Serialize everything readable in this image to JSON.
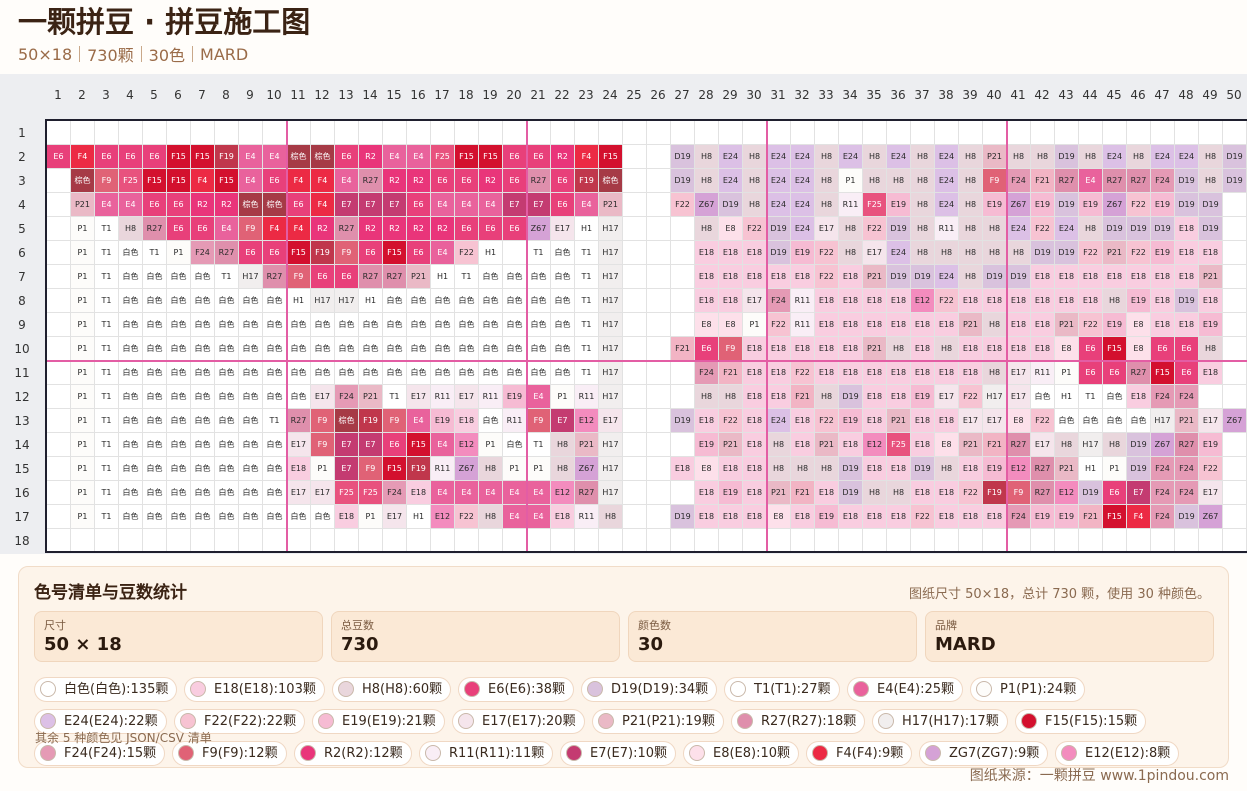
{
  "header": {
    "title": "一颗拼豆 · 拼豆施工图",
    "size": "50×18",
    "beads": "730颗",
    "colors": "30色",
    "brand": "MARD"
  },
  "grid": {
    "cols": 50,
    "rows": 18,
    "major_every": 10,
    "rows_data": [
      [],
      [
        "E6",
        "F4",
        "E6",
        "E6",
        "E6",
        "F15",
        "F15",
        "F19",
        "E4",
        "E4",
        "棕色",
        "棕色",
        "E6",
        "R2",
        "E4",
        "E4",
        "F25",
        "F15",
        "F15",
        "E6",
        "E6",
        "R2",
        "F4",
        "F15",
        "",
        "",
        "D19",
        "H8",
        "E24",
        "H8",
        "E24",
        "E24",
        "H8",
        "E24",
        "H8",
        "E24",
        "H8",
        "E24",
        "H8",
        "P21",
        "H8",
        "H8",
        "D19",
        "H8",
        "E24",
        "H8",
        "E24",
        "E24",
        "H8",
        "D19"
      ],
      [
        "",
        "棕色",
        "F9",
        "F25",
        "F15",
        "F15",
        "F4",
        "F15",
        "E4",
        "E6",
        "F4",
        "F4",
        "E4",
        "R27",
        "R2",
        "R2",
        "E6",
        "E6",
        "R2",
        "E6",
        "R27",
        "E6",
        "F19",
        "棕色",
        "",
        "",
        "D19",
        "H8",
        "E24",
        "H8",
        "E24",
        "E24",
        "H8",
        "P1",
        "H8",
        "H8",
        "H8",
        "E24",
        "H8",
        "F9",
        "F24",
        "F21",
        "R27",
        "E4",
        "R27",
        "R27",
        "F24",
        "D19",
        "H8",
        "D19"
      ],
      [
        "",
        "P21",
        "E4",
        "E4",
        "E6",
        "E6",
        "R2",
        "R2",
        "棕色",
        "棕色",
        "E6",
        "F4",
        "E7",
        "E7",
        "E7",
        "E6",
        "E4",
        "E4",
        "E4",
        "E7",
        "E7",
        "E6",
        "E4",
        "P21",
        "",
        "",
        "F22",
        "Z67",
        "D19",
        "H8",
        "E24",
        "E24",
        "H8",
        "R11",
        "F25",
        "E19",
        "H8",
        "E24",
        "H8",
        "E19",
        "Z67",
        "E19",
        "D19",
        "E19",
        "Z67",
        "F22",
        "E19",
        "D19",
        "D19",
        ""
      ],
      [
        "",
        "P1",
        "T1",
        "H8",
        "R27",
        "E6",
        "E6",
        "E4",
        "F9",
        "F4",
        "F4",
        "R2",
        "R27",
        "R2",
        "R2",
        "R2",
        "R2",
        "E6",
        "E6",
        "E6",
        "Z67",
        "E17",
        "H1",
        "H17",
        "",
        "",
        "",
        "H8",
        "E8",
        "F22",
        "D19",
        "E24",
        "E17",
        "H8",
        "F22",
        "D19",
        "H8",
        "R11",
        "H8",
        "H8",
        "E24",
        "F22",
        "E24",
        "H8",
        "D19",
        "D19",
        "D19",
        "E18",
        "D19",
        ""
      ],
      [
        "",
        "P1",
        "T1",
        "白色",
        "T1",
        "P1",
        "F24",
        "R27",
        "E6",
        "E6",
        "F15",
        "F19",
        "F9",
        "E6",
        "F15",
        "E6",
        "E4",
        "F22",
        "H1",
        "",
        "T1",
        "白色",
        "T1",
        "H17",
        "",
        "",
        "",
        "E18",
        "E18",
        "E18",
        "D19",
        "E19",
        "F22",
        "H8",
        "E17",
        "E24",
        "H8",
        "H8",
        "H8",
        "H8",
        "H8",
        "D19",
        "D19",
        "F22",
        "P21",
        "F22",
        "E19",
        "E18",
        "E18",
        ""
      ],
      [
        "",
        "P1",
        "T1",
        "白色",
        "白色",
        "白色",
        "白色",
        "T1",
        "H17",
        "R27",
        "F9",
        "E6",
        "E6",
        "R27",
        "R27",
        "P21",
        "H1",
        "T1",
        "白色",
        "白色",
        "白色",
        "白色",
        "T1",
        "H17",
        "",
        "",
        "",
        "E18",
        "E18",
        "E18",
        "E18",
        "E18",
        "F22",
        "E18",
        "P21",
        "D19",
        "D19",
        "E24",
        "H8",
        "D19",
        "D19",
        "E18",
        "E18",
        "E18",
        "E18",
        "E18",
        "E18",
        "E18",
        "P21",
        ""
      ],
      [
        "",
        "P1",
        "T1",
        "白色",
        "白色",
        "白色",
        "白色",
        "白色",
        "白色",
        "白色",
        "H1",
        "H17",
        "H17",
        "H1",
        "白色",
        "白色",
        "白色",
        "白色",
        "白色",
        "白色",
        "白色",
        "白色",
        "T1",
        "H17",
        "",
        "",
        "",
        "E18",
        "E18",
        "E17",
        "F24",
        "R11",
        "E18",
        "E18",
        "E18",
        "E18",
        "E12",
        "F22",
        "E18",
        "E18",
        "E18",
        "E18",
        "E18",
        "E18",
        "H8",
        "E19",
        "E18",
        "D19",
        "E18",
        ""
      ],
      [
        "",
        "P1",
        "T1",
        "白色",
        "白色",
        "白色",
        "白色",
        "白色",
        "白色",
        "白色",
        "白色",
        "白色",
        "白色",
        "白色",
        "白色",
        "白色",
        "白色",
        "白色",
        "白色",
        "白色",
        "白色",
        "白色",
        "T1",
        "H17",
        "",
        "",
        "",
        "E8",
        "E8",
        "P1",
        "F22",
        "R11",
        "E18",
        "E18",
        "E18",
        "E18",
        "E18",
        "E18",
        "P21",
        "H8",
        "E18",
        "E18",
        "P21",
        "F22",
        "E19",
        "E8",
        "E18",
        "E18",
        "E19",
        ""
      ],
      [
        "",
        "P1",
        "T1",
        "白色",
        "白色",
        "白色",
        "白色",
        "白色",
        "白色",
        "白色",
        "白色",
        "白色",
        "白色",
        "白色",
        "白色",
        "白色",
        "白色",
        "白色",
        "白色",
        "白色",
        "白色",
        "白色",
        "T1",
        "H17",
        "",
        "",
        "F21",
        "E6",
        "F9",
        "E18",
        "E18",
        "E18",
        "E18",
        "E18",
        "P21",
        "H8",
        "E18",
        "H8",
        "E18",
        "E18",
        "E18",
        "E18",
        "E8",
        "E6",
        "F15",
        "E8",
        "E6",
        "E6",
        "H8",
        ""
      ],
      [
        "",
        "P1",
        "T1",
        "白色",
        "白色",
        "白色",
        "白色",
        "白色",
        "白色",
        "白色",
        "白色",
        "白色",
        "白色",
        "白色",
        "白色",
        "白色",
        "白色",
        "白色",
        "白色",
        "白色",
        "白色",
        "白色",
        "T1",
        "H17",
        "",
        "",
        "",
        "F24",
        "F21",
        "E18",
        "E18",
        "F22",
        "E18",
        "E18",
        "E18",
        "E18",
        "E18",
        "E18",
        "E18",
        "H8",
        "E17",
        "R11",
        "P1",
        "E6",
        "E6",
        "R27",
        "F15",
        "E6",
        "E18",
        ""
      ],
      [
        "",
        "P1",
        "T1",
        "白色",
        "白色",
        "白色",
        "白色",
        "白色",
        "白色",
        "白色",
        "白色",
        "E17",
        "F24",
        "P21",
        "T1",
        "E17",
        "R11",
        "E17",
        "R11",
        "E19",
        "E4",
        "P1",
        "R11",
        "H17",
        "",
        "",
        "",
        "H8",
        "H8",
        "E18",
        "E18",
        "F21",
        "H8",
        "D19",
        "E18",
        "E18",
        "E19",
        "E17",
        "F22",
        "H17",
        "E17",
        "白色",
        "H1",
        "T1",
        "白色",
        "E18",
        "F24",
        "F24",
        "",
        ""
      ],
      [
        "",
        "P1",
        "T1",
        "白色",
        "白色",
        "白色",
        "白色",
        "白色",
        "白色",
        "T1",
        "R27",
        "F9",
        "棕色",
        "F19",
        "F9",
        "E4",
        "E19",
        "E18",
        "白色",
        "R11",
        "F9",
        "E7",
        "E12",
        "E17",
        "",
        "",
        "D19",
        "E18",
        "F22",
        "E18",
        "E24",
        "E18",
        "F22",
        "E19",
        "E18",
        "P21",
        "E18",
        "E18",
        "E17",
        "E17",
        "E8",
        "F22",
        "白色",
        "白色",
        "白色",
        "白色",
        "H17",
        "P21",
        "E17",
        "Z67"
      ],
      [
        "",
        "P1",
        "T1",
        "白色",
        "白色",
        "白色",
        "白色",
        "白色",
        "白色",
        "白色",
        "E17",
        "F9",
        "E7",
        "E7",
        "E6",
        "F15",
        "E4",
        "E12",
        "P1",
        "白色",
        "T1",
        "H8",
        "P21",
        "H17",
        "",
        "",
        "",
        "E19",
        "P21",
        "E18",
        "H8",
        "E18",
        "P21",
        "E18",
        "E12",
        "F25",
        "E18",
        "E8",
        "P21",
        "F21",
        "R27",
        "E17",
        "H8",
        "H17",
        "H8",
        "D19",
        "Z67",
        "R27",
        "E19",
        ""
      ],
      [
        "",
        "P1",
        "T1",
        "白色",
        "白色",
        "白色",
        "白色",
        "白色",
        "白色",
        "白色",
        "E18",
        "P1",
        "E7",
        "F9",
        "F15",
        "F19",
        "R11",
        "Z67",
        "H8",
        "P1",
        "P1",
        "H8",
        "Z67",
        "H17",
        "",
        "",
        "E18",
        "E8",
        "E18",
        "E18",
        "H8",
        "H8",
        "H8",
        "D19",
        "E18",
        "E18",
        "D19",
        "H8",
        "E18",
        "E19",
        "E12",
        "R27",
        "P21",
        "H1",
        "P1",
        "D19",
        "F24",
        "F24",
        "F22",
        ""
      ],
      [
        "",
        "P1",
        "T1",
        "白色",
        "白色",
        "白色",
        "白色",
        "白色",
        "白色",
        "白色",
        "E17",
        "E17",
        "F25",
        "F25",
        "F24",
        "E18",
        "E4",
        "E4",
        "E4",
        "E4",
        "E4",
        "E12",
        "R27",
        "H17",
        "",
        "",
        "",
        "E18",
        "E19",
        "E18",
        "P21",
        "F21",
        "E18",
        "D19",
        "H8",
        "H8",
        "E18",
        "E18",
        "F22",
        "F19",
        "F9",
        "R27",
        "E12",
        "D19",
        "E6",
        "E7",
        "F24",
        "F24",
        "E17",
        ""
      ],
      [
        "",
        "P1",
        "T1",
        "白色",
        "白色",
        "白色",
        "白色",
        "白色",
        "白色",
        "白色",
        "白色",
        "白色",
        "E18",
        "P1",
        "E17",
        "H1",
        "E12",
        "F22",
        "H8",
        "E4",
        "E4",
        "E18",
        "R11",
        "H8",
        "",
        "",
        "D19",
        "E18",
        "E18",
        "E18",
        "E8",
        "E18",
        "E19",
        "E18",
        "E18",
        "E18",
        "F22",
        "E18",
        "E18",
        "E18",
        "F24",
        "E19",
        "E19",
        "F21",
        "F15",
        "F4",
        "F24",
        "D19",
        "Z67",
        ""
      ],
      []
    ]
  },
  "panel": {
    "title": "色号清单与豆数统计",
    "summary": "图纸尺寸 50×18，总计 730 颗，使用 30 种颜色。",
    "stats": [
      {
        "label": "尺寸",
        "value": "50 × 18"
      },
      {
        "label": "总豆数",
        "value": "730"
      },
      {
        "label": "颜色数",
        "value": "30"
      },
      {
        "label": "品牌",
        "value": "MARD"
      }
    ],
    "chips": [
      {
        "text": "白色(白色):135颗",
        "color": "#ffffff"
      },
      {
        "text": "E18(E18):103颗",
        "color": "#f9cde0"
      },
      {
        "text": "H8(H8):60颗",
        "color": "#e9d6dc"
      },
      {
        "text": "E6(E6):38颗",
        "color": "#e8407a"
      },
      {
        "text": "D19(D19):34颗",
        "color": "#d9c2dd"
      },
      {
        "text": "T1(T1):27颗",
        "color": "#ffffff"
      },
      {
        "text": "E4(E4):25颗",
        "color": "#e9629c"
      },
      {
        "text": "P1(P1):24颗",
        "color": "#fdfcfa"
      },
      {
        "text": "E24(E24):22颗",
        "color": "#dcc0e6"
      },
      {
        "text": "F22(F22):22颗",
        "color": "#f7c3d2"
      },
      {
        "text": "E19(E19):21颗",
        "color": "#f6bbd3"
      },
      {
        "text": "E17(E17):20颗",
        "color": "#f5e5ec"
      },
      {
        "text": "P21(P21):19颗",
        "color": "#eab9c6"
      },
      {
        "text": "R27(R27):18颗",
        "color": "#df8fac"
      },
      {
        "text": "H17(H17):17颗",
        "color": "#f1eeee"
      },
      {
        "text": "F15(F15):15颗",
        "color": "#d3102e"
      },
      {
        "text": "F24(F24):15颗",
        "color": "#e59ab5"
      },
      {
        "text": "F9(F9):12颗",
        "color": "#e06276"
      },
      {
        "text": "R2(R2):12颗",
        "color": "#e9357a"
      },
      {
        "text": "R11(R11):11颗",
        "color": "#f9eef6"
      },
      {
        "text": "E7(E7):10颗",
        "color": "#c43b71"
      },
      {
        "text": "E8(E8):10颗",
        "color": "#fde0ea"
      },
      {
        "text": "F4(F4):9颗",
        "color": "#ec2a44"
      },
      {
        "text": "ZG7(ZG7):9颗",
        "color": "#d5a2d6"
      },
      {
        "text": "E12(E12):8颗",
        "color": "#f38cbe"
      }
    ],
    "more": "其余 5 种颜色见 JSON/CSV 清单",
    "source": "图纸来源：一颗拼豆 www.1pindou.com"
  },
  "bead_colors": {
    "E6": "#e8407a",
    "F4": "#ec2a44",
    "F15": "#d3102e",
    "F19": "#c0374c",
    "E4": "#e9629c",
    "棕色": "#a63a46",
    "R2": "#e9357a",
    "F25": "#e8527e",
    "F9": "#e06276",
    "R27": "#df8fac",
    "P21": "#eab9c6",
    "E7": "#c43b71",
    "E17": "#f5e5ec",
    "Z67": "#d5a2d6",
    "H1": "#ffffff",
    "H17": "#f1eeee",
    "P1": "#fdfcfa",
    "T1": "#ffffff",
    "H8": "#e9d6dc",
    "白色": "#ffffff",
    "F24": "#e59ab5",
    "F22": "#f7c3d2",
    "E12": "#f38cbe",
    "E19": "#f6bbd3",
    "E18": "#f9cde0",
    "R11": "#f9eef6",
    "D19": "#d9c2dd",
    "E24": "#dcc0e6",
    "E8": "#fde0ea",
    "F21": "#f2b4c4"
  },
  "dark_text_codes": [
    "E6",
    "F4",
    "F15",
    "F19",
    "棕色",
    "R2",
    "F25",
    "F9",
    "E7",
    "E4"
  ]
}
